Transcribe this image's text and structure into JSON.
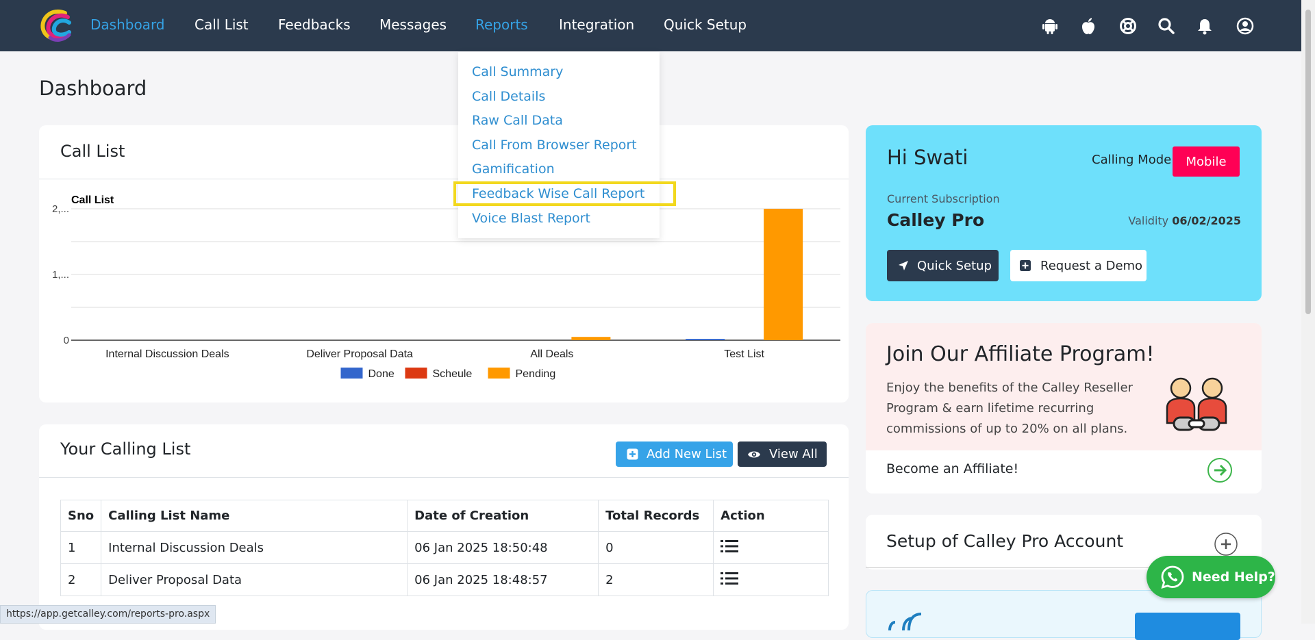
{
  "nav": {
    "items": [
      "Dashboard",
      "Call List",
      "Feedbacks",
      "Messages",
      "Reports",
      "Integration",
      "Quick Setup"
    ],
    "icons": [
      "android-icon",
      "apple-icon",
      "support-icon",
      "search-icon",
      "bell-icon",
      "user-icon"
    ]
  },
  "reports_menu": {
    "items": [
      "Call Summary",
      "Call Details",
      "Raw Call Data",
      "Call From Browser Report",
      "Gamification",
      "Feedback Wise Call Report",
      "Voice Blast Report"
    ]
  },
  "page": {
    "title": "Dashboard"
  },
  "call_list_card": {
    "title": "Call List"
  },
  "chart_data": {
    "type": "bar",
    "title": "Call List",
    "categories": [
      "Internal Discussion Deals",
      "Deliver Proposal Data",
      "All Deals",
      "Test List"
    ],
    "series": [
      {
        "name": "Done",
        "color": "#3366cc",
        "values": [
          0,
          0,
          0,
          2
        ]
      },
      {
        "name": "Scheule",
        "color": "#dc3912",
        "values": [
          0,
          0,
          0,
          0
        ]
      },
      {
        "name": "Pending",
        "color": "#ff9900",
        "values": [
          0,
          0,
          5,
          200
        ]
      }
    ],
    "y_tick_labels": [
      "0",
      "1,...",
      "2,..."
    ],
    "ylim": [
      0,
      200
    ],
    "grid": true,
    "legend": "bottom"
  },
  "calling_list": {
    "title": "Your Calling List",
    "add_button": "Add New List",
    "view_button": "View All",
    "columns": [
      "Sno",
      "Calling List Name",
      "Date of Creation",
      "Total Records",
      "Action"
    ],
    "rows": [
      {
        "sno": "1",
        "name": "Internal Discussion Deals",
        "date": "06 Jan 2025 18:50:48",
        "records": "0"
      },
      {
        "sno": "2",
        "name": "Deliver Proposal Data",
        "date": "06 Jan 2025 18:48:57",
        "records": "2"
      }
    ]
  },
  "profile": {
    "greeting": "Hi Swati",
    "mode_label": "Calling Mode:",
    "mode_value": "Mobile",
    "subscription_label": "Current Subscription",
    "plan": "Calley Pro",
    "validity_label": "Validity",
    "validity_date": "06/02/2025",
    "quick_setup": "Quick Setup",
    "request_demo": "Request a Demo"
  },
  "affiliate": {
    "title": "Join Our Affiliate Program!",
    "text_lines": [
      "Enjoy the benefits of the Calley Reseller",
      "Program & earn lifetime recurring",
      "commissions of up to 20% on all plans."
    ],
    "link": "Become an Affiliate!"
  },
  "setup": {
    "title": "Setup of Calley Pro Account"
  },
  "help": {
    "label": "Need Help?"
  },
  "status_url": "https://app.getcalley.com/reports-pro.aspx",
  "colors": {
    "nav": "#2b3a4d",
    "accent": "#35a3e6",
    "profile_card": "#6ee0fb",
    "affiliate_card": "#fdeeee",
    "mobile_badge": "#ff0055",
    "help_button": "#2db548"
  }
}
